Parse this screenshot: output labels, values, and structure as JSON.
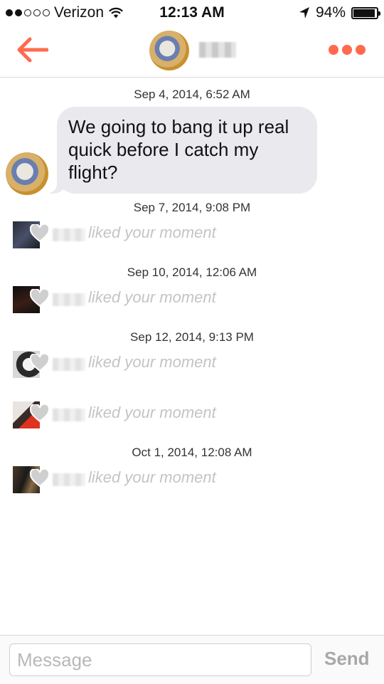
{
  "status_bar": {
    "carrier": "Verizon",
    "time": "12:13 AM",
    "battery": "94%",
    "battery_level": 0.94
  },
  "header": {
    "back_icon": "arrow-left-icon",
    "more_icon": "more-dots-icon",
    "accent": "#ff6a4e"
  },
  "conversation": {
    "timestamps": [
      "Sep 4, 2014, 6:52 AM",
      "Sep 7, 2014, 9:08 PM",
      "Sep 10, 2014, 12:06 AM",
      "Sep 12, 2014, 9:13 PM",
      "Oct 1, 2014, 12:08 AM"
    ],
    "message": "We going to bang it up real quick before I catch my flight?",
    "likes": [
      {
        "text": "liked your moment"
      },
      {
        "text": "liked your moment"
      },
      {
        "text": "liked your moment"
      },
      {
        "text": "liked your moment"
      },
      {
        "text": "liked your moment"
      }
    ]
  },
  "input": {
    "placeholder": "Message",
    "send_label": "Send"
  }
}
